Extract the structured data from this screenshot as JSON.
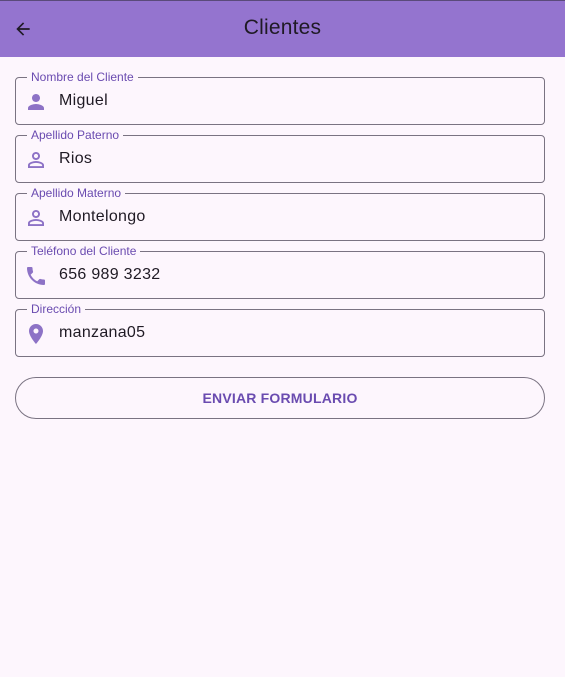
{
  "appbar": {
    "title": "Clientes",
    "back_icon": "arrow-back-icon",
    "background_color": "#9474cf"
  },
  "form": {
    "fields": [
      {
        "label": "Nombre del Cliente",
        "value": "Miguel",
        "icon": "person-icon"
      },
      {
        "label": "Apellido Paterno",
        "value": "Rios",
        "icon": "person-outline-icon"
      },
      {
        "label": "Apellido Materno",
        "value": "Montelongo",
        "icon": "person-outline-icon"
      },
      {
        "label": "Teléfono del Cliente",
        "value": "656 989 3232",
        "icon": "phone-icon"
      },
      {
        "label": "Dirección",
        "value": "manzana05",
        "icon": "location-pin-icon"
      }
    ],
    "submit_label": "ENVIAR FORMULARIO"
  },
  "colors": {
    "accent": "#6a4bb0",
    "icon": "#8d72c6",
    "page_background": "#fdf6fd"
  }
}
